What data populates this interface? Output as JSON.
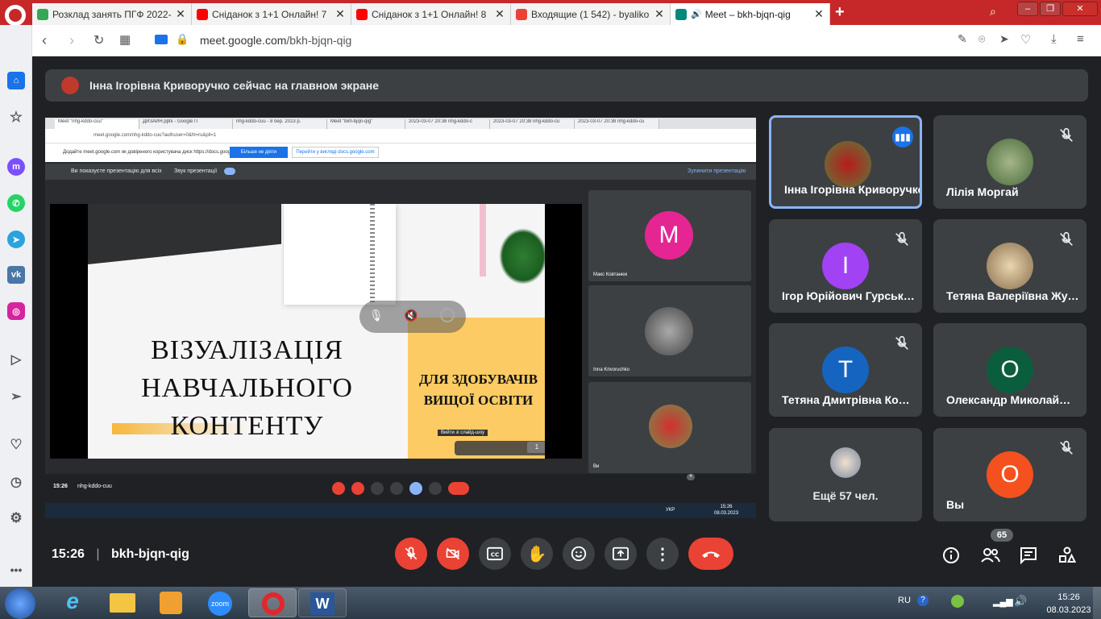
{
  "browser": {
    "tabs": [
      {
        "title": "Розклад занять ПГФ 2022-",
        "fav_color": "#34a853",
        "active": false
      },
      {
        "title": "Сніданок з 1+1 Онлайн! 7",
        "fav_color": "#ff0000",
        "active": false
      },
      {
        "title": "Сніданок з 1+1 Онлайн! 8",
        "fav_color": "#ff0000",
        "active": false
      },
      {
        "title": "Входящие (1 542) - byaliko",
        "fav_color": "#ea4335",
        "active": false
      },
      {
        "title": "Meet – bkh-bjqn-qig",
        "fav_color": "#00897b",
        "active": true
      }
    ],
    "new_tab": "+",
    "url_host": "meet.google.com",
    "url_path": "/bkh-bjqn-qig"
  },
  "meet": {
    "banner_text": "Інна Ігорівна Криворучко сейчас на главном экране",
    "time": "15:26",
    "meeting_code": "bkh-bjqn-qig",
    "participant_count": "65",
    "accent_color": "#8ab4f8",
    "danger_color": "#ea4335"
  },
  "shared_screen": {
    "inner_tabs": [
      "Meet \"nhg-kddo-cuu\"",
      "ДИЗАЙН.pptx - Google П",
      "nhg-kddo-cuu - 8 бер. 2023 р.",
      "Meet \"bkh-bjqn-qig\"",
      "2023-03-07 20:38 nhg-kddo-c",
      "2023-03-07 20:38 nhg-kddo-cu",
      "2023-03-07 20:38 nhg-kddo-cu"
    ],
    "inner_url": "meet.google.com/nhg-kddo-cuu?authuser=0&hl=ru&pli=1",
    "inner_info": "Додайте meet.google.com як довіреного користувача диск https://docs.google.com",
    "inner_info_button": "Більше не діяти",
    "inner_info_link": "Перейти у виглядi docs.google.com",
    "presenting_text": "Ви показуєте презентацію для всіх",
    "sound_text": "Звук презентації",
    "stop_text": "Зупинити презентацію",
    "slide_title": "ВІЗУАЛІЗАЦІЯ НАВЧАЛЬНОГО КОНТЕНТУ",
    "slide_subtitle": "ДЛЯ ЗДОБУВАЧІВ ВИЩОЇ ОСВІТИ",
    "slide_tooltip": "Вийти зі слайд-шоу",
    "slide_page": "1",
    "inner_participants": [
      {
        "name": "Макс Ковтанюк",
        "letter": "М",
        "color": "#e52592"
      },
      {
        "name": "Inna Krivoruchko",
        "letter": "",
        "color": "#6b6b6b"
      },
      {
        "name": "Ви",
        "letter": "",
        "color": "#c0392b"
      }
    ],
    "inner_time": "15:26",
    "inner_code": "nhg-kddo-cuu",
    "inner_count": "4",
    "inner_taskbar_lang": "УКР",
    "inner_taskbar_time": "15:26",
    "inner_taskbar_date": "08.03.2023"
  },
  "participants": [
    {
      "name": "Інна Ігорівна Криворучко",
      "display": "Інна Ігорівна Криворучко",
      "letter": "",
      "color": "#c0392b",
      "photo": true,
      "speaking": true,
      "muted": false
    },
    {
      "name": "Лілія Моргай",
      "display": "Лілія Моргай",
      "letter": "",
      "color": "#4a6b3a",
      "photo": true,
      "speaking": false,
      "muted": true
    },
    {
      "name": "Ігор Юрійович Гурськ",
      "display": "Ігор Юрійович Гурськ…",
      "letter": "І",
      "color": "#a142f4",
      "photo": false,
      "speaking": false,
      "muted": true
    },
    {
      "name": "Тетяна Валеріївна Жу",
      "display": "Тетяна Валеріївна Жу…",
      "letter": "",
      "color": "#8a6d4a",
      "photo": true,
      "speaking": false,
      "muted": true
    },
    {
      "name": "Тетяна Дмитрівна Ко",
      "display": "Тетяна Дмитрівна Ко…",
      "letter": "Т",
      "color": "#1565c0",
      "photo": false,
      "speaking": false,
      "muted": true
    },
    {
      "name": "Олександр Миколай",
      "display": "Олександр Миколай…",
      "letter": "О",
      "color": "#0b5e3d",
      "photo": false,
      "speaking": false,
      "muted": false
    },
    {
      "name": "Ещё 57 чел.",
      "display": "Ещё 57 чел.",
      "letter": "",
      "color": "#9aa0a6",
      "photo": true,
      "speaking": false,
      "muted": false,
      "more": true
    },
    {
      "name": "Вы",
      "display": "Вы",
      "letter": "О",
      "color": "#f4511e",
      "photo": false,
      "speaking": false,
      "muted": true
    }
  ],
  "taskbar": {
    "lang": "RU",
    "time": "15:26",
    "date": "08.03.2023",
    "apps": [
      "ie-icon",
      "explorer-icon",
      "media-player-icon",
      "zoom-icon",
      "opera-icon",
      "word-icon"
    ],
    "zoom_label": "zoom"
  }
}
